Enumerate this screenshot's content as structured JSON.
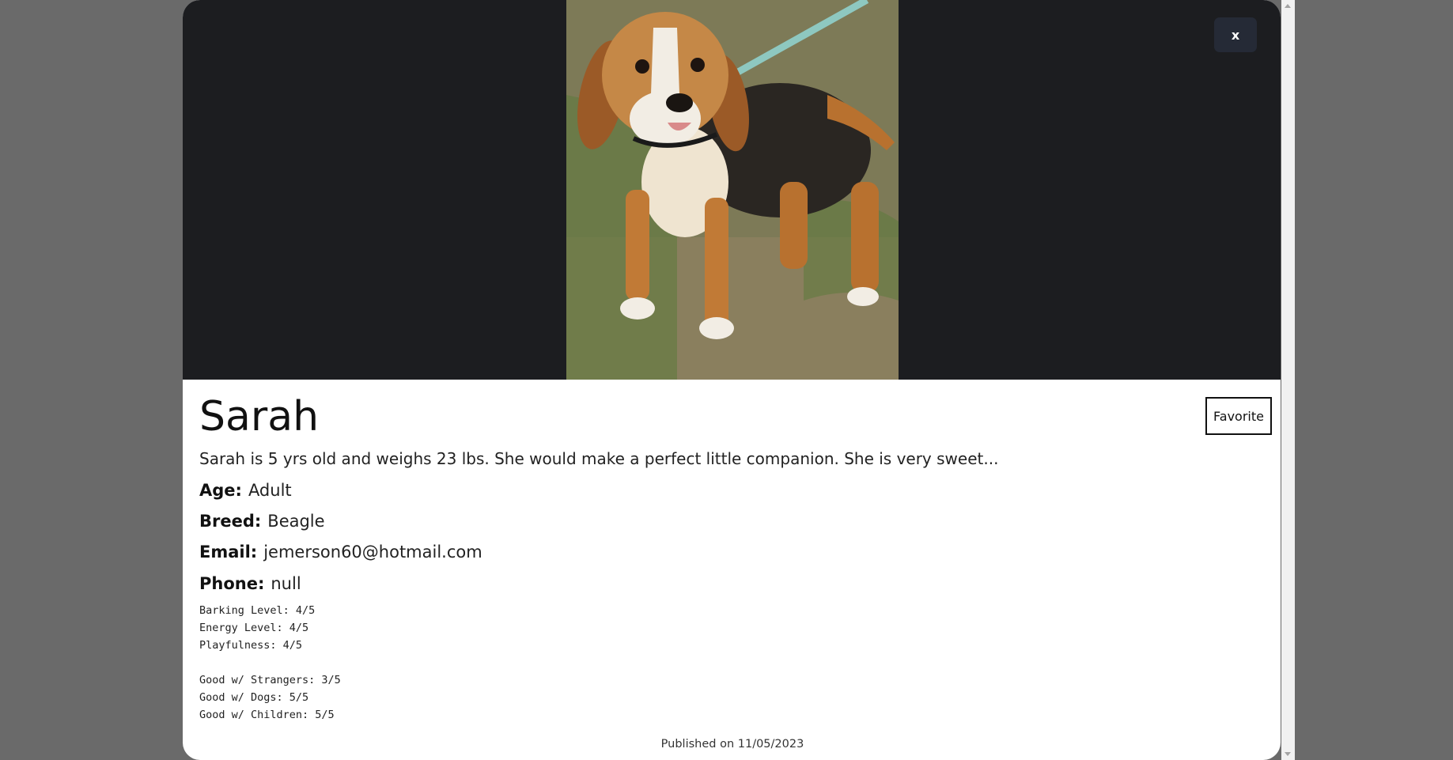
{
  "modal": {
    "close_label": "x",
    "photo_icon": "dog-photo"
  },
  "pet": {
    "name": "Sarah",
    "favorite_label": "Favorite",
    "description": "Sarah is 5 yrs old and weighs 23 lbs. She would make a perfect little companion. She is very sweet...",
    "fields": [
      {
        "key": "Age:",
        "value": "Adult"
      },
      {
        "key": "Breed:",
        "value": "Beagle"
      },
      {
        "key": "Email:",
        "value": "jemerson60@hotmail.com"
      },
      {
        "key": "Phone:",
        "value": "null"
      }
    ],
    "stats": [
      "Barking Level: 4/5",
      "Energy Level: 4/5",
      "Playfulness: 4/5"
    ],
    "social": [
      "Good w/ Strangers: 3/5",
      "Good w/ Dogs: 5/5",
      "Good w/ Children: 5/5"
    ],
    "published": "Published on 11/05/2023"
  },
  "colors": {
    "backdrop": "#6a6a6a",
    "hero_bg": "#1c1d20",
    "close_button_bg": "#252a36"
  }
}
